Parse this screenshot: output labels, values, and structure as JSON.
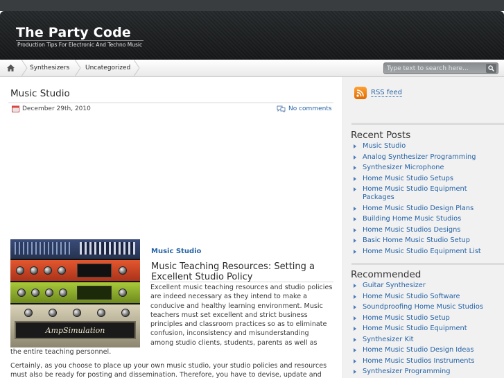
{
  "site": {
    "title": "The Party Code",
    "tagline": "Production Tips For Electronic And Techno Music"
  },
  "nav": {
    "home_icon": "home-icon",
    "items": [
      "Synthesizers",
      "Uncategorized"
    ]
  },
  "search": {
    "placeholder": "Type text to search here...",
    "button_icon": "search-icon"
  },
  "post": {
    "title": "Music Studio",
    "date": "December 29th, 2010",
    "comments": "No comments",
    "category": "Music Studio",
    "heading": "Music Teaching Resources: Setting a Excellent Studio Policy",
    "para1": "Excellent music teaching resources and studio policies are indeed necessary as they intend to make a conducive and healthy learning environment. Music teachers must set excellent and strict business principles and classroom practices so as to eliminate confusion, inconsistency and misunderstanding among studio clients, students, parents as well as",
    "para1_tail": "the entire teaching personnel.",
    "para2": "Certainly, as you choose to place up your own music studio, your studio policies and resources must also be ready for posting and dissemination. Therefore, you have to devise, update and",
    "image_text": "AmpSimulation"
  },
  "sidebar": {
    "rss_label": "RSS feed",
    "recent_title": "Recent Posts",
    "recent": [
      "Music Studio",
      "Analog Synthesizer Programming",
      "Synthesizer Microphone",
      "Home Music Studio Setups",
      "Home Music Studio Equipment Packages",
      "Home Music Studio Design Plans",
      "Building Home Music Studios",
      "Home Music Studios Designs",
      "Basic Home Music Studio Setup",
      "Home Music Studio Equipment List"
    ],
    "recommended_title": "Recommended",
    "recommended": [
      "Guitar Synthesizer",
      "Home Music Studio Software",
      "Soundproofing Home Music Studios",
      "Home Music Studio Setup",
      "Home Music Studio Equipment",
      "Synthesizer Kit",
      "Home Music Studio Design Ideas",
      "Home Music Studios Instruments",
      "Synthesizer Programming"
    ]
  },
  "colors": {
    "link": "#2563a6",
    "header_bg": "#1c1e20",
    "rss_orange": "#f28a1a"
  }
}
